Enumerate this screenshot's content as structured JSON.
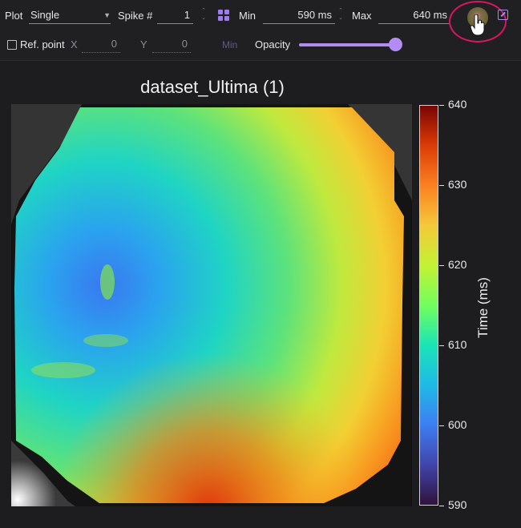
{
  "toolbar": {
    "plot_label": "Plot",
    "plot_value": "Single",
    "spike_label": "Spike #",
    "spike_value": "1",
    "min_label": "Min",
    "min_value": "590 ms",
    "max_label": "Max",
    "max_value": "640 ms",
    "ref_point_label": "Ref. point",
    "x_label": "X",
    "x_value": "0",
    "y_label": "Y",
    "y_value": "0",
    "min_button_label": "Min",
    "opacity_label": "Opacity",
    "opacity_level": 0.95,
    "ref_point_checked": false
  },
  "colors": {
    "accent": "#9d7cf2",
    "highlight_ring": "#d81660",
    "background": "#1d1d1f"
  },
  "icons": {
    "plot_dropdown": "chevron-down-icon",
    "layout": "grid-icon",
    "color_scheme": "palette-icon",
    "cursor": "hand-pointer-icon",
    "export": "external-link-icon"
  },
  "chart_data": {
    "type": "heatmap",
    "title": "dataset_Ultima  (1)",
    "colorbar_label": "Time (ms)",
    "colorbar_ticks": [
      "640",
      "630",
      "620",
      "610",
      "600",
      "590"
    ],
    "range": [
      590,
      640
    ],
    "colormap": "turbo"
  }
}
